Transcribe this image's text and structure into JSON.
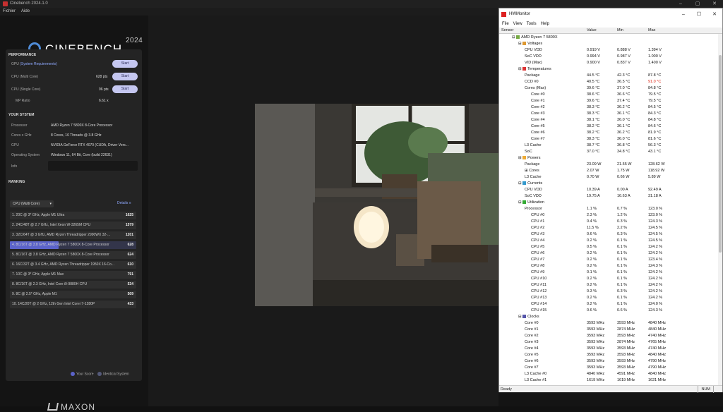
{
  "cinebench": {
    "window_title": "Cinebench 2024.1.0",
    "window_controls": [
      "–",
      "▢",
      "✕"
    ],
    "menu": [
      "Fichier",
      "Aide"
    ],
    "logo_text": "CINEBENCH",
    "logo_year": "2024",
    "performance": {
      "header": "PERFORMANCE",
      "rows": [
        {
          "label": "GPU",
          "link": "(System Requirements)",
          "score": "-",
          "button": "Start"
        },
        {
          "label": "CPU (Multi Core)",
          "score": "628 pts",
          "button": "Start"
        },
        {
          "label": "CPU (Single Core)",
          "score": "96 pts",
          "button": "Start"
        }
      ],
      "mp_label": "MP Ratio",
      "mp_value": "6.61 x"
    },
    "system": {
      "header": "YOUR SYSTEM",
      "rows": [
        {
          "label": "Processor",
          "value": "AMD Ryzen 7 5800X 8-Core Processor"
        },
        {
          "label": "Cores x GHz",
          "value": "8 Cores, 16 Threads @ 3.8 GHz"
        },
        {
          "label": "GPU",
          "value": "NVIDIA GeForce RTX 4070 (CUDA, Driver Vers..."
        },
        {
          "label": "Operating System",
          "value": "Windows 11, 64 Bit, Core (build 22631)"
        },
        {
          "label": "Info",
          "value": ""
        }
      ]
    },
    "ranking": {
      "header": "RANKING",
      "select_value": "CPU (Multi Core)",
      "details_label": "Details",
      "max_score": 1625,
      "items": [
        {
          "name": "1. 20C @ 3* GHz, Apple M1 Ultra",
          "score": 1625,
          "highlight": false
        },
        {
          "name": "2. 24C/48T @ 2.7 GHz, Intel Xeon W-3265M CPU",
          "score": 1579,
          "highlight": false
        },
        {
          "name": "3. 32C/64T @ 3 GHz, AMD Ryzen Threadripper 2990WX 32-...",
          "score": 1201,
          "highlight": false
        },
        {
          "name": "4. 8C/16T @ 3.8 GHz, AMD Ryzen 7 5800X 8-Core Processor",
          "score": 628,
          "highlight": true
        },
        {
          "name": "5. 8C/16T @ 3.8 GHz, AMD Ryzen 7 5800X 8-Core Processor",
          "score": 624,
          "highlight": false
        },
        {
          "name": "6. 16C/32T @ 3.4 GHz, AMD Ryzen Threadripper 1950X 16-Co...",
          "score": 610,
          "highlight": false
        },
        {
          "name": "7. 10C @ 3* GHz, Apple M1 Max",
          "score": 791,
          "highlight": false
        },
        {
          "name": "8. 8C/16T @ 2.3 GHz, Intel Core i9-9880H CPU",
          "score": 534,
          "highlight": false
        },
        {
          "name": "9. 8C @ 2.5* GHz, Apple M1",
          "score": 509,
          "highlight": false
        },
        {
          "name": "10. 14C/20T @ 2 GHz, 12th Gen Intel Core i7-1280P",
          "score": 433,
          "highlight": false
        }
      ],
      "legend_your": "Your Score",
      "legend_identical": "Identical System"
    },
    "footer_logo": "MAXON"
  },
  "hwmonitor": {
    "title": "HWMonitor",
    "controls": [
      "–",
      "☐",
      "✕"
    ],
    "menu": [
      "File",
      "View",
      "Tools",
      "Help"
    ],
    "columns": [
      "Sensor",
      "Value",
      "Min",
      "Max"
    ],
    "status": "Ready",
    "num": "NUM",
    "rows": [
      {
        "indent": 2,
        "name": "AMD Ryzen 7 5800X",
        "icon": "chip",
        "v": "",
        "mn": "",
        "mx": ""
      },
      {
        "indent": 3,
        "name": "Voltages",
        "icon": "volt",
        "v": "",
        "mn": "",
        "mx": ""
      },
      {
        "indent": 4,
        "name": "CPU VDD",
        "v": "0.919 V",
        "mn": "0.888 V",
        "mx": "1.394 V"
      },
      {
        "indent": 4,
        "name": "SoC VDD",
        "v": "0.994 V",
        "mn": "0.987 V",
        "mx": "1.000 V"
      },
      {
        "indent": 4,
        "name": "VID (Max)",
        "v": "0.900 V",
        "mn": "0.837 V",
        "mx": "1.400 V"
      },
      {
        "indent": 3,
        "name": "Temperatures",
        "icon": "temp",
        "v": "",
        "mn": "",
        "mx": ""
      },
      {
        "indent": 4,
        "name": "Package",
        "v": "44.5 °C",
        "mn": "42.3 °C",
        "mx": "87.8 °C"
      },
      {
        "indent": 4,
        "name": "CCD #0",
        "v": "40.5 °C",
        "mn": "36.5 °C",
        "mx": "91.0 °C",
        "red": true
      },
      {
        "indent": 4,
        "name": "Cores (Max)",
        "v": "39.6 °C",
        "mn": "37.0 °C",
        "mx": "84.8 °C"
      },
      {
        "indent": 5,
        "name": "Core #0",
        "v": "38.6 °C",
        "mn": "36.6 °C",
        "mx": "79.5 °C"
      },
      {
        "indent": 5,
        "name": "Core #1",
        "v": "39.6 °C",
        "mn": "37.4 °C",
        "mx": "79.5 °C"
      },
      {
        "indent": 5,
        "name": "Core #2",
        "v": "38.3 °C",
        "mn": "36.2 °C",
        "mx": "84.5 °C"
      },
      {
        "indent": 5,
        "name": "Core #3",
        "v": "38.3 °C",
        "mn": "36.1 °C",
        "mx": "84.3 °C"
      },
      {
        "indent": 5,
        "name": "Core #4",
        "v": "38.1 °C",
        "mn": "36.0 °C",
        "mx": "84.8 °C"
      },
      {
        "indent": 5,
        "name": "Core #5",
        "v": "38.2 °C",
        "mn": "36.1 °C",
        "mx": "84.6 °C"
      },
      {
        "indent": 5,
        "name": "Core #6",
        "v": "38.2 °C",
        "mn": "36.2 °C",
        "mx": "81.9 °C"
      },
      {
        "indent": 5,
        "name": "Core #7",
        "v": "38.3 °C",
        "mn": "36.0 °C",
        "mx": "81.6 °C"
      },
      {
        "indent": 4,
        "name": "L3 Cache",
        "v": "38.7 °C",
        "mn": "36.8 °C",
        "mx": "56.3 °C"
      },
      {
        "indent": 4,
        "name": "SoC",
        "v": "37.0 °C",
        "mn": "34.8 °C",
        "mx": "43.1 °C"
      },
      {
        "indent": 3,
        "name": "Powers",
        "icon": "power",
        "v": "",
        "mn": "",
        "mx": ""
      },
      {
        "indent": 4,
        "name": "Package",
        "v": "23.09 W",
        "mn": "21.55 W",
        "mx": "128.62 W"
      },
      {
        "indent": 4,
        "name": "Cores",
        "v": "2.07 W",
        "mn": "1.75 W",
        "mx": "118.92 W",
        "expand": true
      },
      {
        "indent": 4,
        "name": "L3 Cache",
        "v": "0.70 W",
        "mn": "0.66 W",
        "mx": "5.89 W"
      },
      {
        "indent": 3,
        "name": "Currents",
        "icon": "current",
        "v": "",
        "mn": "",
        "mx": ""
      },
      {
        "indent": 4,
        "name": "CPU VDD",
        "v": "10.39 A",
        "mn": "0.00 A",
        "mx": "92.49 A"
      },
      {
        "indent": 4,
        "name": "SoC VDD",
        "v": "19.75 A",
        "mn": "16.63 A",
        "mx": "31.18 A"
      },
      {
        "indent": 3,
        "name": "Utilization",
        "icon": "util",
        "v": "",
        "mn": "",
        "mx": ""
      },
      {
        "indent": 4,
        "name": "Processor",
        "v": "1.1 %",
        "mn": "0.7 %",
        "mx": "123.0 %"
      },
      {
        "indent": 5,
        "name": "CPU #0",
        "v": "2.3 %",
        "mn": "1.2 %",
        "mx": "123.0 %"
      },
      {
        "indent": 5,
        "name": "CPU #1",
        "v": "0.4 %",
        "mn": "0.3 %",
        "mx": "124.3 %"
      },
      {
        "indent": 5,
        "name": "CPU #2",
        "v": "11.5 %",
        "mn": "2.2 %",
        "mx": "124.5 %"
      },
      {
        "indent": 5,
        "name": "CPU #3",
        "v": "0.6 %",
        "mn": "0.3 %",
        "mx": "124.5 %"
      },
      {
        "indent": 5,
        "name": "CPU #4",
        "v": "0.2 %",
        "mn": "0.1 %",
        "mx": "124.5 %"
      },
      {
        "indent": 5,
        "name": "CPU #5",
        "v": "0.5 %",
        "mn": "0.1 %",
        "mx": "124.2 %"
      },
      {
        "indent": 5,
        "name": "CPU #6",
        "v": "0.2 %",
        "mn": "0.1 %",
        "mx": "124.2 %"
      },
      {
        "indent": 5,
        "name": "CPU #7",
        "v": "0.2 %",
        "mn": "0.1 %",
        "mx": "123.4 %"
      },
      {
        "indent": 5,
        "name": "CPU #8",
        "v": "0.2 %",
        "mn": "0.1 %",
        "mx": "124.3 %"
      },
      {
        "indent": 5,
        "name": "CPU #9",
        "v": "0.1 %",
        "mn": "0.1 %",
        "mx": "124.2 %"
      },
      {
        "indent": 5,
        "name": "CPU #10",
        "v": "0.2 %",
        "mn": "0.1 %",
        "mx": "124.2 %"
      },
      {
        "indent": 5,
        "name": "CPU #11",
        "v": "0.2 %",
        "mn": "0.1 %",
        "mx": "124.2 %"
      },
      {
        "indent": 5,
        "name": "CPU #12",
        "v": "0.3 %",
        "mn": "0.3 %",
        "mx": "124.2 %"
      },
      {
        "indent": 5,
        "name": "CPU #13",
        "v": "0.2 %",
        "mn": "0.1 %",
        "mx": "124.2 %"
      },
      {
        "indent": 5,
        "name": "CPU #14",
        "v": "0.2 %",
        "mn": "0.1 %",
        "mx": "124.0 %"
      },
      {
        "indent": 5,
        "name": "CPU #15",
        "v": "0.6 %",
        "mn": "0.6 %",
        "mx": "124.3 %"
      },
      {
        "indent": 3,
        "name": "Clocks",
        "icon": "clock",
        "v": "",
        "mn": "",
        "mx": ""
      },
      {
        "indent": 4,
        "name": "Core #0",
        "v": "3593 MHz",
        "mn": "3593 MHz",
        "mx": "4840 MHz"
      },
      {
        "indent": 4,
        "name": "Core #1",
        "v": "3593 MHz",
        "mn": "2874 MHz",
        "mx": "4840 MHz"
      },
      {
        "indent": 4,
        "name": "Core #2",
        "v": "3593 MHz",
        "mn": "3593 MHz",
        "mx": "4740 MHz"
      },
      {
        "indent": 4,
        "name": "Core #3",
        "v": "3593 MHz",
        "mn": "2874 MHz",
        "mx": "4765 MHz"
      },
      {
        "indent": 4,
        "name": "Core #4",
        "v": "3593 MHz",
        "mn": "3593 MHz",
        "mx": "4740 MHz"
      },
      {
        "indent": 4,
        "name": "Core #5",
        "v": "3593 MHz",
        "mn": "3593 MHz",
        "mx": "4840 MHz"
      },
      {
        "indent": 4,
        "name": "Core #6",
        "v": "3593 MHz",
        "mn": "3593 MHz",
        "mx": "4790 MHz"
      },
      {
        "indent": 4,
        "name": "Core #7",
        "v": "3593 MHz",
        "mn": "3593 MHz",
        "mx": "4790 MHz"
      },
      {
        "indent": 4,
        "name": "L3 Cache #0",
        "v": "4840 MHz",
        "mn": "4591 MHz",
        "mx": "4840 MHz"
      },
      {
        "indent": 4,
        "name": "L3 Cache #1",
        "v": "1619 MHz",
        "mn": "1619 MHz",
        "mx": "1621 MHz"
      }
    ]
  }
}
